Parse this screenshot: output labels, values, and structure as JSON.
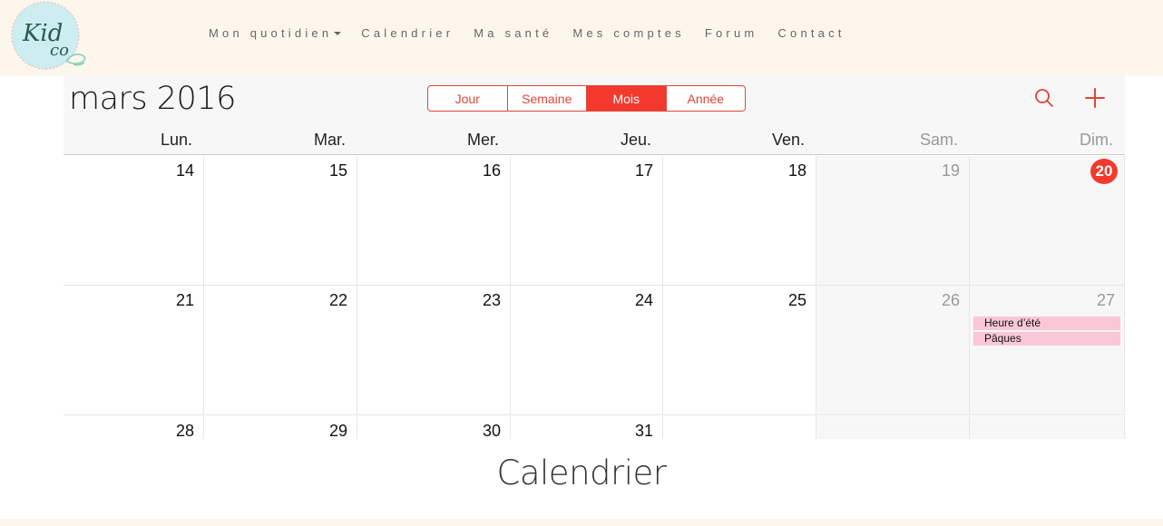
{
  "brand": {
    "logo_text_line1": "Kid",
    "logo_text_line2": "co",
    "colors": {
      "header_bg": "#fdf6ec",
      "logo_circle": "#cdeef0",
      "logo_text": "#2f5a4f",
      "accent_red": "#f3392d"
    }
  },
  "nav": {
    "items": [
      {
        "label": "Mon quotidien",
        "has_dropdown": true
      },
      {
        "label": "Calendrier"
      },
      {
        "label": "Ma santé"
      },
      {
        "label": "Mes comptes"
      },
      {
        "label": "Forum"
      },
      {
        "label": "Contact"
      }
    ]
  },
  "calendar": {
    "month_title": "mars 2016",
    "view_buttons": [
      {
        "label": "Jour",
        "active": false
      },
      {
        "label": "Semaine",
        "active": false
      },
      {
        "label": "Mois",
        "active": true
      },
      {
        "label": "Année",
        "active": false
      }
    ],
    "icons": {
      "search": "search-icon",
      "add": "plus-icon"
    },
    "weekdays": [
      "Lun.",
      "Mar.",
      "Mer.",
      "Jeu.",
      "Ven.",
      "Sam.",
      "Dim."
    ],
    "weeks": [
      [
        "14",
        "15",
        "16",
        "17",
        "18",
        "19",
        "20"
      ],
      [
        "21",
        "22",
        "23",
        "24",
        "25",
        "26",
        "27"
      ],
      [
        "28",
        "29",
        "30",
        "31",
        "",
        "",
        ""
      ]
    ],
    "today": "20",
    "events": {
      "week_1_day_6": [
        "Heure d’été",
        "Pâques"
      ]
    },
    "event_color": "#f9c7d6"
  },
  "caption": "Calendrier"
}
